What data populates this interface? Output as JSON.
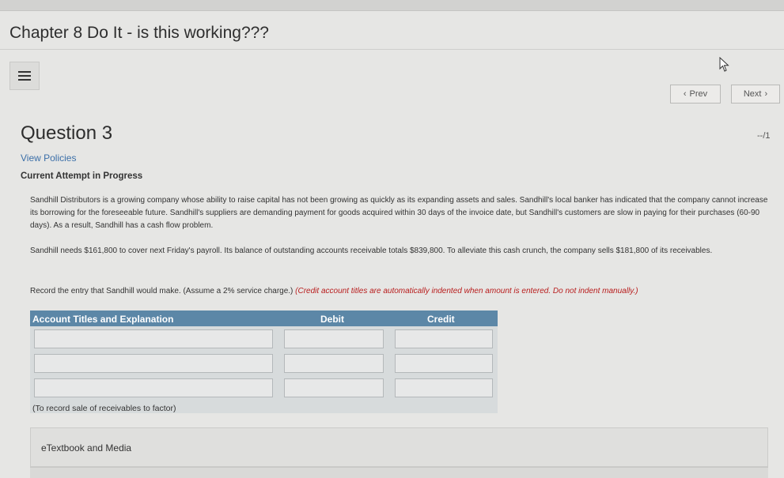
{
  "page": {
    "title": "Chapter 8 Do It - is this working???"
  },
  "nav": {
    "prev_label": "Prev",
    "next_label": "Next"
  },
  "question": {
    "title": "Question 3",
    "score": "--/1",
    "view_policies": "View Policies",
    "attempt_label": "Current Attempt in Progress",
    "paragraph1": "Sandhill Distributors is a growing company whose ability to raise capital has not been growing as quickly as its expanding assets and sales. Sandhill's local banker has indicated that the company cannot increase its borrowing for the foreseeable future. Sandhill's suppliers are demanding payment for goods acquired within 30 days of the invoice date, but Sandhill's customers are slow in paying for their purchases (60-90 days). As a result, Sandhill has a cash flow problem.",
    "paragraph2": "Sandhill needs $161,800 to cover next Friday's payroll. Its balance of outstanding accounts receivable totals $839,800. To alleviate this cash crunch, the company sells $181,800 of its receivables.",
    "paragraph3": "Record the entry that Sandhill would make. (Assume a 2% service charge.)",
    "instruction": "(Credit account titles are automatically indented when amount is entered. Do not indent manually.)"
  },
  "journal": {
    "headers": {
      "account": "Account Titles and Explanation",
      "debit": "Debit",
      "credit": "Credit"
    },
    "rows": [
      {
        "account": "",
        "debit": "",
        "credit": ""
      },
      {
        "account": "",
        "debit": "",
        "credit": ""
      },
      {
        "account": "",
        "debit": "",
        "credit": ""
      }
    ],
    "note": "(To record sale of receivables to factor)"
  },
  "resources": {
    "etextbook_label": "eTextbook and Media"
  },
  "icons": {
    "menu": "hamburger-menu-icon",
    "cursor": "mouse-cursor-icon",
    "prev": "chevron-left-icon",
    "next": "chevron-right-icon"
  },
  "colors": {
    "header_blue": "#5c87a7",
    "link_blue": "#3b6fa8",
    "instruction_red": "#b81c1c"
  }
}
